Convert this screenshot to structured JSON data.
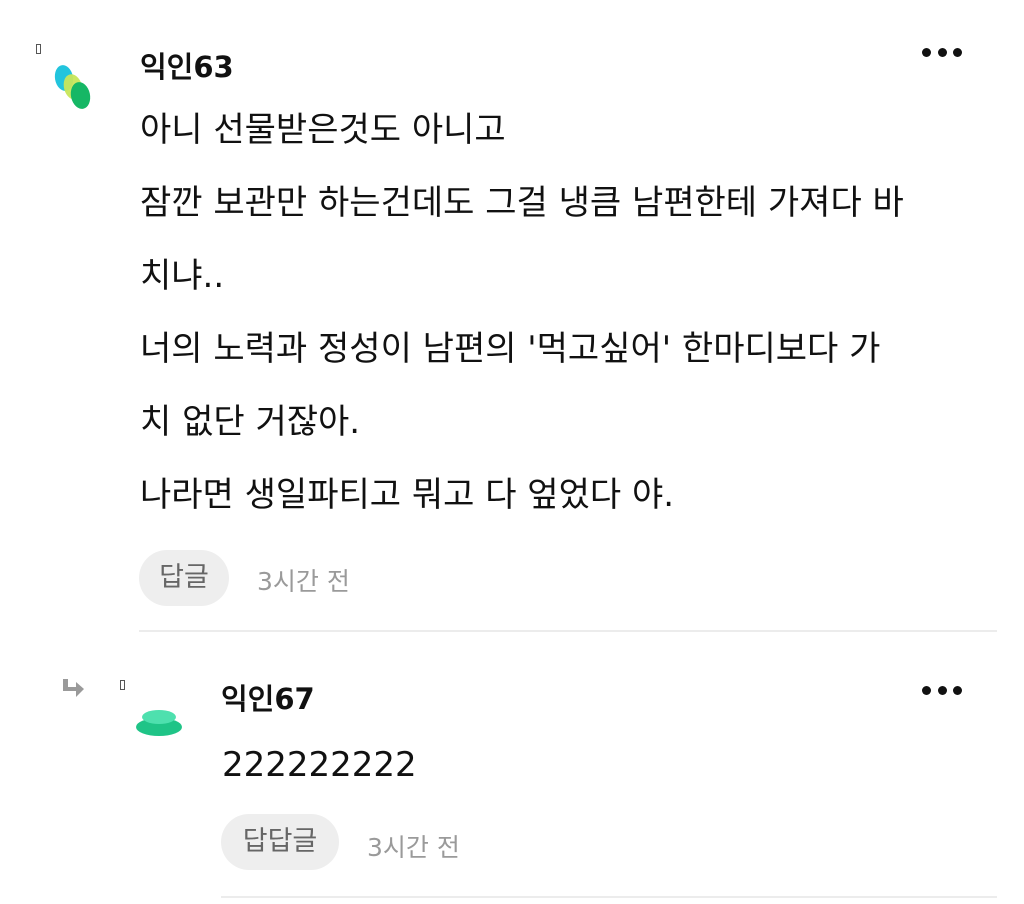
{
  "comments": [
    {
      "author": "익인63",
      "lines": [
        "아니 선물받은것도 아니고",
        "잠깐 보관만 하는건데도 그걸 냉큼 남편한테 가져다 바",
        "치냐..",
        "너의 노력과 정성이 남편의 '먹고싶어' 한마디보다 가",
        "치 없단 거잖아.",
        "나라면 생일파티고 뭐고 다 엎었다 야."
      ],
      "reply_label": "답글",
      "timestamp": "3시간 전"
    },
    {
      "author": "익인67",
      "lines": [
        "222222222"
      ],
      "reply_label": "답답글",
      "timestamp": "3시간 전"
    }
  ],
  "icons": {
    "more": "more-horizontal-icon",
    "reply_arrow": "reply-arrow-icon"
  },
  "colors": {
    "text": "#111111",
    "muted": "#9a9a9a",
    "pill_bg": "#eeeeee",
    "divider": "#ececec",
    "avatar1": [
      "#22c4dd",
      "#c8e65a",
      "#16b765"
    ],
    "avatar2": [
      "#4ee0ae",
      "#1fc487"
    ]
  }
}
